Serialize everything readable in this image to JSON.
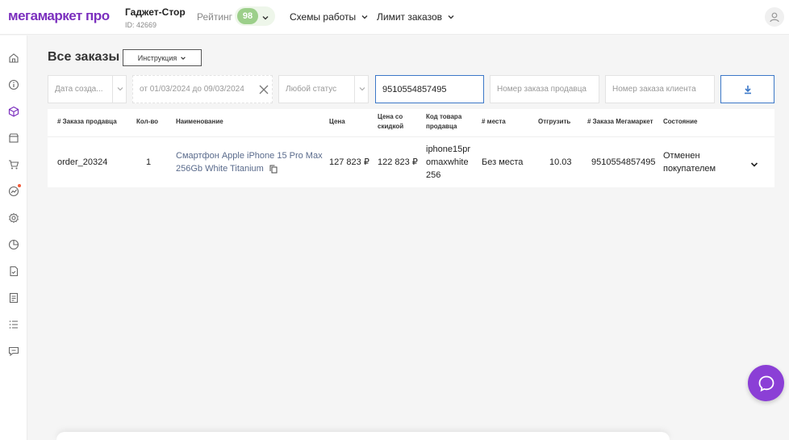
{
  "header": {
    "logo": "мегамаркет про",
    "shop_name": "Гаджет-Стор",
    "shop_id": "ID: 42669",
    "rating_label": "Рейтинг",
    "rating_value": "98",
    "menu_schemes": "Схемы работы",
    "menu_limit": "Лимит заказов"
  },
  "sidebar": {
    "icons": [
      "home-icon",
      "info-icon",
      "box-icon",
      "store-icon",
      "cart-icon",
      "analytics-icon",
      "settings-icon",
      "chart-pie-icon",
      "document-icon",
      "notes-icon",
      "list-icon",
      "feedback-icon"
    ],
    "active": "box-icon"
  },
  "page": {
    "title": "Все заказы",
    "instructions_button": "Инструкция"
  },
  "filters": {
    "date_type": "Дата созда...",
    "date_range": "от 01/03/2024  до 09/03/2024",
    "status": "Любой статус",
    "search_value": "9510554857495",
    "seller_order_placeholder": "Номер заказа продавца",
    "client_order_placeholder": "Номер заказа клиента"
  },
  "table": {
    "headers": {
      "seller_order": "# Заказа продавца",
      "qty": "Кол-во",
      "name": "Наименование",
      "price": "Цена",
      "discount_price_1": "Цена со",
      "discount_price_2": "скидкой",
      "sku_1": "Код товара",
      "sku_2": "продавца",
      "places": "# места",
      "ship": "Отгрузить",
      "mm_order": "# Заказа Мегамаркет",
      "status": "Состояние"
    },
    "rows": [
      {
        "seller_order": "order_20324",
        "qty": "1",
        "name_1": "Смартфон Apple iPhone 15 Pro Max",
        "name_2": "256Gb White Titanium",
        "price": "127 823 ₽",
        "discount_price": "122 823 ₽",
        "sku_1": "iphone15pr",
        "sku_2": "omaxwhite",
        "sku_3": "256",
        "places": "Без места",
        "ship": "10.03",
        "mm_order": "9510554857495",
        "status_1": "Отменен",
        "status_2": "покупателем"
      }
    ]
  },
  "colors": {
    "brand": "#7b2fbe",
    "accent_blue": "#3c78c8",
    "rating_green": "#9ccf8a",
    "chat": "#8b3fd6"
  }
}
